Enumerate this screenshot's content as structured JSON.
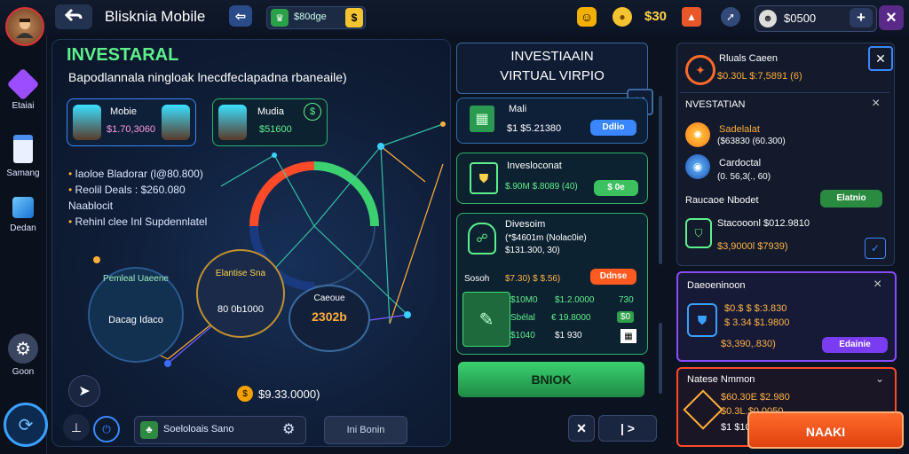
{
  "header": {
    "back_icon": "back-arrow-icon",
    "title": "Blisknia Mobile",
    "share_icon": "arrow-icon",
    "currency_label": "$80dge",
    "currency_badge": "$",
    "smiley_icon": "smiley-icon",
    "coin_icon": "coin-icon",
    "amount": "$30",
    "fire_icon": "fire-icon",
    "rocket_icon": "rocket-icon",
    "balance": "$0500",
    "plus_label": "+",
    "close_label": "×"
  },
  "left_nav": {
    "items": [
      {
        "label": "Etaiai",
        "icon": "gem-icon"
      },
      {
        "label": "Samang",
        "icon": "document-icon"
      },
      {
        "label": "Dedan",
        "icon": "cube-icon"
      },
      {
        "label": "Goon",
        "icon": "gear-icon"
      }
    ],
    "bottom_icon": "shield-icon"
  },
  "main": {
    "title": "INVESTARAL",
    "subtitle": "Bapodlannala ningloak lnecdfeclapadna rbaneaile)",
    "profile_cards": [
      {
        "name": "Mobie",
        "value": "$1.70,3060"
      },
      {
        "name": "Mudia",
        "value": "$51600"
      }
    ],
    "stats": [
      "Iaoloe Bladorar (l@80.800)",
      "Reolil Deals : $260.080",
      "Naablocit",
      "Rehinl clee Inl Supdennlatel"
    ],
    "nodes": [
      {
        "title": "Pemleal Uaeene",
        "value": "Dacag Idaco"
      },
      {
        "title": "Elantise Sna",
        "value": "80 0b1000"
      },
      {
        "title": "Caeoue",
        "value": "2302b"
      }
    ],
    "coin_amount": "$9.33.0000)",
    "arrow_icon": "cursor-icon",
    "bottom_left_icon": "pin-icon",
    "toggle_icon": "power-icon",
    "dropdown_label": "Soeloloais Sano",
    "settings_icon": "gear-icon",
    "action_button": "Ini Bonin"
  },
  "center_panel": {
    "title_line1": "INVESTIAAIN",
    "title_line2": "VIRTUAL VIRPIO",
    "close_icon": "close-icon",
    "cards": [
      {
        "name": "Mali",
        "value": "$1 $5.21380",
        "button": "Ddlio"
      },
      {
        "name": "Invesloconat",
        "value": "$.90M $.8089 (40)",
        "button": "$ 0e"
      },
      {
        "name": "Divesoim",
        "lines": [
          "(*$4601m (Nolac0ie)",
          "$131.300, 30)"
        ],
        "label": "Sosoh",
        "value": "$7.30) $ $.56)",
        "button": "Ddnse"
      }
    ],
    "sub_rows": [
      {
        "a": "$10M0",
        "b": "$1.2.0000",
        "c": "730"
      },
      {
        "a": "Sbélal",
        "b": "€ 19.8000",
        "c": "$0"
      },
      {
        "a": "$1040",
        "b": "$1 930",
        "c": ""
      }
    ],
    "primary_button": "BNIOK",
    "nav_close": "×",
    "nav_next": "|  >"
  },
  "right_panel": {
    "top_item": {
      "title": "Rluals Caeen",
      "value": "$0.30L $:7,5891 (6)"
    },
    "close_icon": "x-icon",
    "section_title": "NVESTATIAN",
    "items": [
      {
        "title": "Sadelalat",
        "value": "($63830 (60.300)"
      },
      {
        "title": "Cardoctal",
        "value": "(0. 56,3(., 60)"
      }
    ],
    "mid_label": "Raucaoe Nbodet",
    "mid_button": "Elatnio",
    "item3": {
      "title": "Stacooonl $012.9810",
      "value": "$3,9000l $7939)"
    },
    "card_purple": {
      "title": "Daeoeninoon",
      "line1": "$0.$ $ $:3.830",
      "line2": "$ 3.34 $1.9800",
      "line3": "$3,390,.830)",
      "button": "Edainie"
    },
    "card_red": {
      "title": "Natese Nmmon",
      "line1": "$60.30E $2.980",
      "line2": "$0.3L.$0.0050",
      "line3": "$1 $10 $.0960"
    },
    "primary_button": "NAAKI"
  },
  "colors": {
    "green": "#2ecc6a",
    "orange": "#ff5a1f",
    "purple": "#7a3cf0",
    "blue": "#2e6fb0"
  }
}
